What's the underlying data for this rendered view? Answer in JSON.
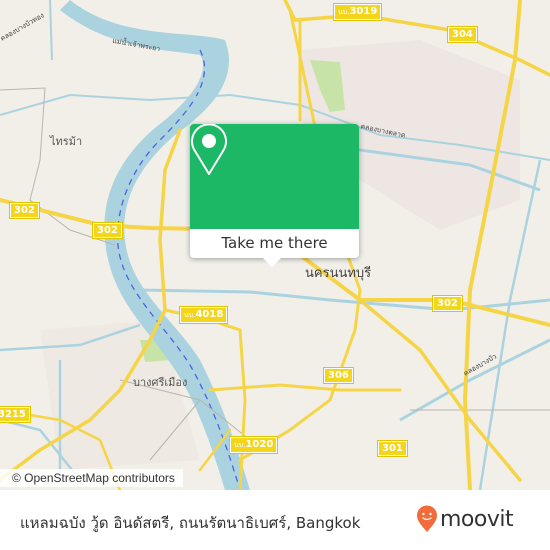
{
  "map": {
    "popup": {
      "button_label": "Take me there",
      "icon": "map-pin-icon",
      "accent_color": "#1db865"
    },
    "places": [
      {
        "name": "ไทรม้า",
        "kind": "district"
      },
      {
        "name": "นครนนทบุรี",
        "kind": "city"
      },
      {
        "name": "บางศรีเมือง",
        "kind": "district"
      }
    ],
    "water_labels": [
      {
        "name": "แม่น้ำเจ้าพระยา"
      },
      {
        "name": "คลองบางบัวทอง"
      },
      {
        "name": "คลองบางตลาด"
      },
      {
        "name": "คลองบางบัว"
      }
    ],
    "road_shields": [
      {
        "prefix": "นบ.",
        "number": "3019"
      },
      {
        "prefix": "",
        "number": "304"
      },
      {
        "prefix": "",
        "number": "302"
      },
      {
        "prefix": "",
        "number": "302"
      },
      {
        "prefix": "",
        "number": "302"
      },
      {
        "prefix": "นบ.",
        "number": "4018"
      },
      {
        "prefix": "",
        "number": "306"
      },
      {
        "prefix": "",
        "number": "3215"
      },
      {
        "prefix": "นบ.",
        "number": "1020"
      },
      {
        "prefix": "",
        "number": "301"
      }
    ],
    "attribution": "© OpenStreetMap contributors"
  },
  "footer": {
    "location_title": "แหลมฉบัง วู้ด อินดัสตรี, ถนนรัตนาธิเบศร์, Bangkok",
    "brand": "moovit",
    "brand_color": "#f26b3a"
  }
}
